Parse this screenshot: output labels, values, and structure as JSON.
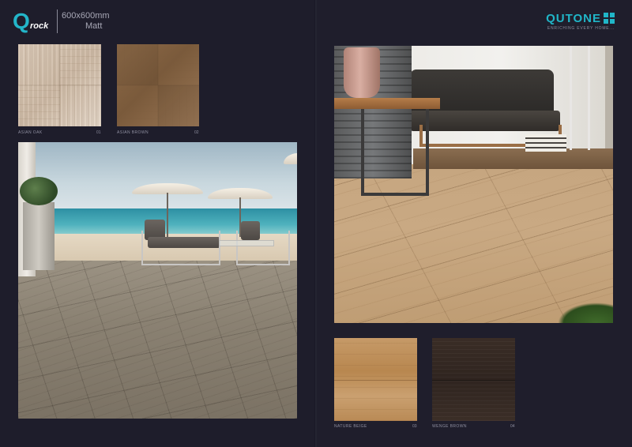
{
  "left_page": {
    "brand": {
      "logo_letter": "Q",
      "logo_word": "rock",
      "size": "600x600mm",
      "finish": "Matt"
    },
    "swatches": [
      {
        "caption": "ASIAN OAK",
        "number": "01"
      },
      {
        "caption": "ASIAN BROWN",
        "number": "02"
      }
    ]
  },
  "right_page": {
    "brand": {
      "name": "QUTONE",
      "tagline": "ENRICHING EVERY HOME..."
    },
    "swatches": [
      {
        "caption": "NATURE BEIGE",
        "number": "03"
      },
      {
        "caption": "WENGE BROWN",
        "number": "04"
      }
    ]
  },
  "colors": {
    "background": "#1e1d2b",
    "brand_accent": "#20b6c8"
  }
}
